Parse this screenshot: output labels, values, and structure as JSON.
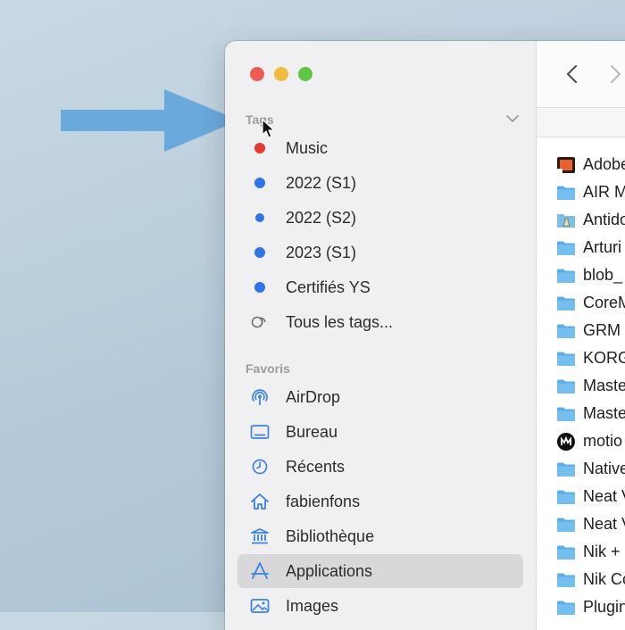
{
  "sidebar": {
    "tags_title": "Tags",
    "tags": [
      {
        "label": "Music",
        "color": "#e23a2f"
      },
      {
        "label": "2022 (S1)",
        "color": "#2f74e8"
      },
      {
        "label": "2022 (S2)",
        "color": "#2f74e8"
      },
      {
        "label": "2023 (S1)",
        "color": "#2f74e8"
      },
      {
        "label": "Certifiés YS",
        "color": "#2f74e8"
      }
    ],
    "all_tags": "Tous les tags...",
    "favorites_title": "Favoris",
    "favorites": [
      {
        "label": "AirDrop",
        "icon": "airdrop-icon"
      },
      {
        "label": "Bureau",
        "icon": "desktop-icon"
      },
      {
        "label": "Récents",
        "icon": "clock-icon"
      },
      {
        "label": "fabienfons",
        "icon": "home-icon"
      },
      {
        "label": "Bibliothèque",
        "icon": "library-icon"
      },
      {
        "label": "Applications",
        "icon": "applications-icon",
        "selected": true
      },
      {
        "label": "Images",
        "icon": "images-icon"
      }
    ]
  },
  "files": [
    {
      "name": "Adobe",
      "icon": "adobe-app-icon"
    },
    {
      "name": "AIR M",
      "icon": "folder-icon"
    },
    {
      "name": "Antido",
      "icon": "antidote-app-icon"
    },
    {
      "name": "Arturi",
      "icon": "folder-icon"
    },
    {
      "name": "blob_",
      "icon": "folder-icon"
    },
    {
      "name": "CoreM",
      "icon": "folder-icon"
    },
    {
      "name": "GRM",
      "icon": "folder-icon"
    },
    {
      "name": "KORG",
      "icon": "folder-icon"
    },
    {
      "name": "Maste",
      "icon": "folder-icon"
    },
    {
      "name": "Maste",
      "icon": "folder-icon"
    },
    {
      "name": "motio",
      "icon": "motion-app-icon"
    },
    {
      "name": "Native",
      "icon": "folder-icon"
    },
    {
      "name": "Neat V",
      "icon": "folder-icon"
    },
    {
      "name": "Neat V",
      "icon": "folder-icon"
    },
    {
      "name": "Nik +",
      "icon": "folder-icon"
    },
    {
      "name": "Nik Co",
      "icon": "folder-icon"
    },
    {
      "name": "Plugin",
      "icon": "folder-icon"
    }
  ],
  "colors": {
    "arrow": "#6aa9dc",
    "folder": "#5aaee8"
  }
}
